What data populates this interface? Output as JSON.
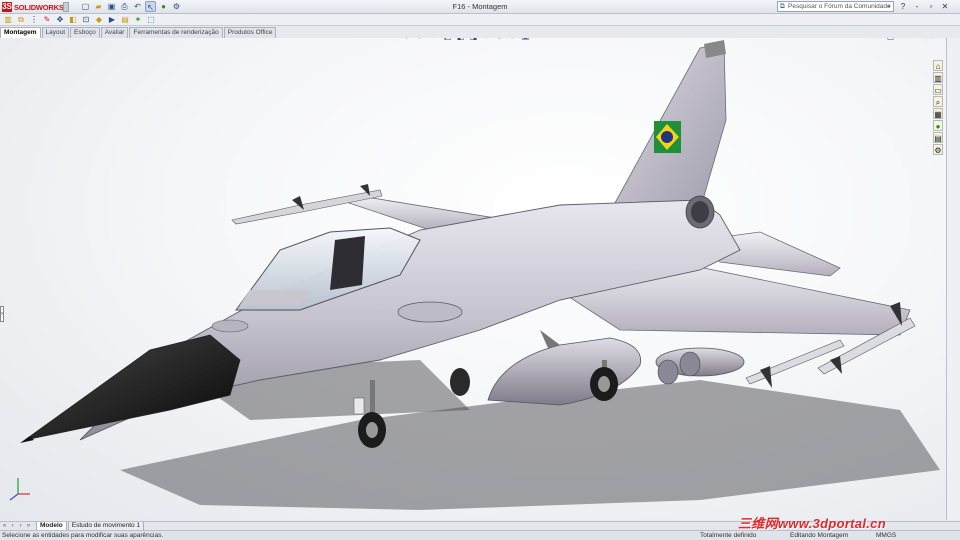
{
  "app": {
    "logo_text": "SOLIDWORKS",
    "document_title": "F16 - Montagem"
  },
  "search": {
    "placeholder": "Pesquisar o Fórum da Comunidade"
  },
  "window_controls": [
    "?",
    "-",
    "▫",
    "✕"
  ],
  "tabs": [
    {
      "label": "Montagem",
      "active": true
    },
    {
      "label": "Layout",
      "active": false
    },
    {
      "label": "Esboço",
      "active": false
    },
    {
      "label": "Avaliar",
      "active": false
    },
    {
      "label": "Ferramentas de renderização",
      "active": false
    },
    {
      "label": "Produtos Office",
      "active": false
    }
  ],
  "bottom_tabs": [
    {
      "label": "Modelo",
      "active": true
    },
    {
      "label": "Estudo de movimento 1",
      "active": false
    }
  ],
  "status": {
    "message": "Selecione as entidades para modificar suas aparências.",
    "definition": "Totalmente definido",
    "editing": "Editando Montagem",
    "units": "MMGS"
  },
  "watermark": "三维网www.3dportal.cn",
  "colors": {
    "brand_red": "#c0161c",
    "watermark_red": "#e2282e",
    "fuselage": "#c3c1cc",
    "canopy": "#dfe7f2",
    "radome": "#141414"
  },
  "icons": {
    "quick_access": [
      "new-doc-icon",
      "open-icon",
      "save-icon",
      "print-icon",
      "undo-icon",
      "select-icon",
      "rebuild-icon",
      "options-icon"
    ],
    "heads_up": [
      "zoom-fit-icon",
      "zoom-area-icon",
      "previous-view-icon",
      "section-view-icon",
      "view-orientation-icon",
      "display-style-icon",
      "hide-show-icon",
      "edit-appearance-icon",
      "apply-scene-icon",
      "view-settings-icon"
    ]
  }
}
